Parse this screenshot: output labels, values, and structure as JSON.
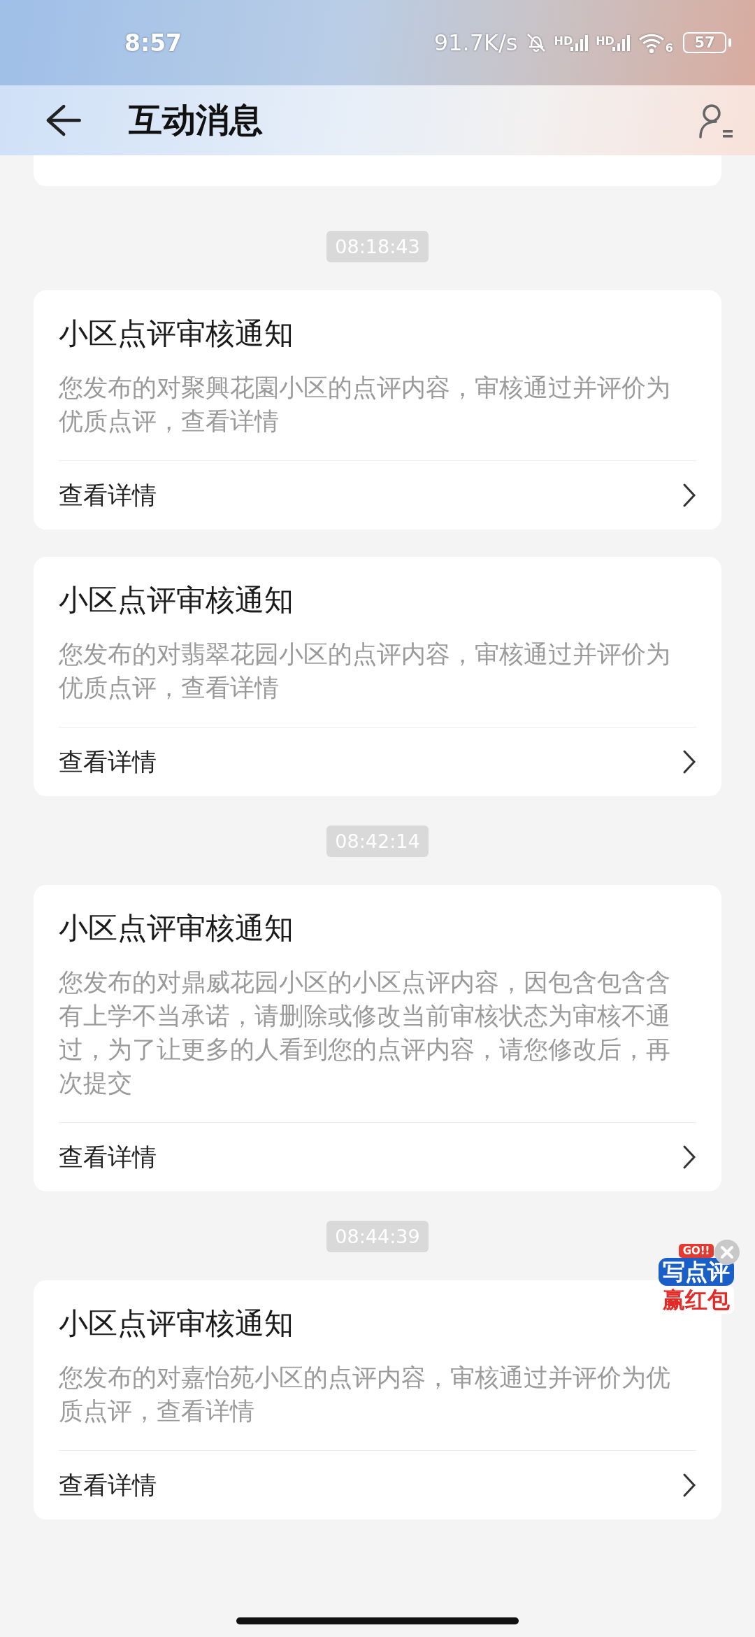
{
  "status_bar": {
    "time": "8:57",
    "speed": "91.7K/s",
    "signals": [
      {
        "label": "HD"
      },
      {
        "label": "HD"
      }
    ],
    "wifi_label": "6",
    "battery": "57"
  },
  "header": {
    "title": "互动消息"
  },
  "feed": [
    {
      "kind": "stub"
    },
    {
      "kind": "time",
      "text": "08:18:43"
    },
    {
      "kind": "card",
      "title": "小区点评审核通知",
      "body": "您发布的对聚興花園小区的点评内容，审核通过并评价为优质点评，查看详情",
      "link": "查看详情"
    },
    {
      "kind": "card",
      "title": "小区点评审核通知",
      "body": "您发布的对翡翠花园小区的点评内容，审核通过并评价为优质点评，查看详情",
      "link": "查看详情"
    },
    {
      "kind": "time",
      "text": "08:42:14"
    },
    {
      "kind": "card",
      "title": "小区点评审核通知",
      "body": "您发布的对鼎威花园小区的小区点评内容，因包含包含含有上学不当承诺，请删除或修改当前审核状态为审核不通过，为了让更多的人看到您的点评内容，请您修改后，再次提交",
      "link": "查看详情"
    },
    {
      "kind": "time",
      "text": "08:44:39"
    },
    {
      "kind": "card",
      "title": "小区点评审核通知",
      "body": "您发布的对嘉怡苑小区的点评内容，审核通过并评价为优质点评，查看详情",
      "link": "查看详情"
    }
  ],
  "promo": {
    "tag": "GO!!",
    "line1": "写点评",
    "line2": "赢红包"
  }
}
